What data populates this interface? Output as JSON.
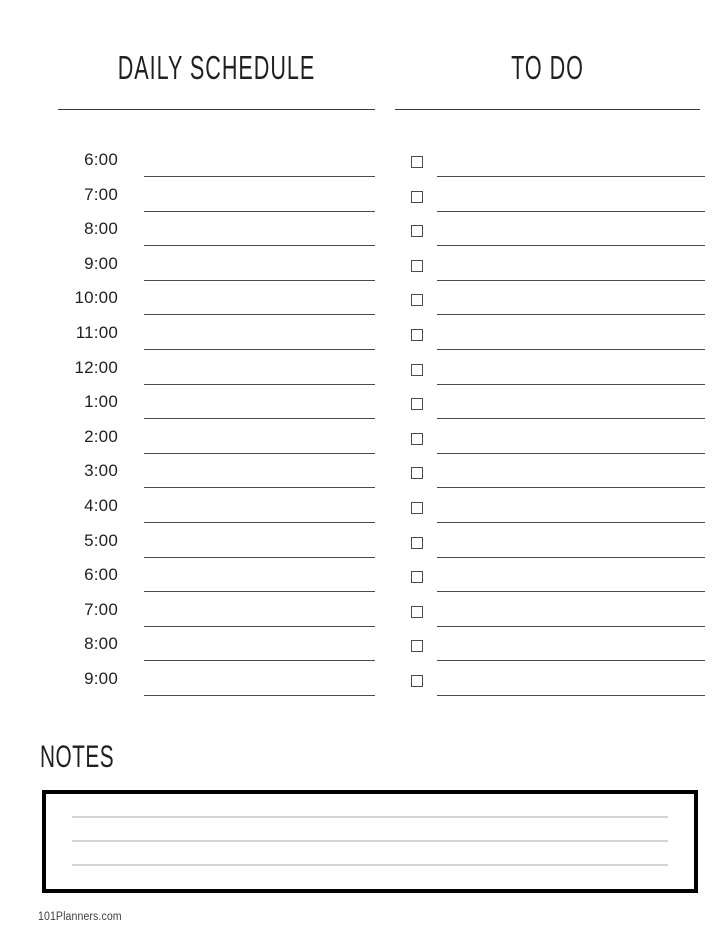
{
  "document": {
    "type": "daily-planner-printable",
    "background": "#ffffff",
    "ink": "#231f20",
    "rule_color": "#4a4a4c",
    "notes_border_color": "#000000",
    "notes_rule_color": "#d4d4d4"
  },
  "schedule": {
    "title": "DAILY SCHEDULE",
    "times": [
      "6:00",
      "7:00",
      "8:00",
      "9:00",
      "10:00",
      "11:00",
      "12:00",
      "1:00",
      "2:00",
      "3:00",
      "4:00",
      "5:00",
      "6:00",
      "7:00",
      "8:00",
      "9:00"
    ]
  },
  "todo": {
    "title": "TO DO",
    "checkbox_icon": "empty-checkbox",
    "items": [
      "",
      "",
      "",
      "",
      "",
      "",
      "",
      "",
      "",
      "",
      "",
      "",
      "",
      "",
      "",
      ""
    ]
  },
  "notes": {
    "title": "NOTES",
    "lines": [
      "",
      "",
      ""
    ]
  },
  "footer": {
    "credit": "101Planners.com"
  }
}
